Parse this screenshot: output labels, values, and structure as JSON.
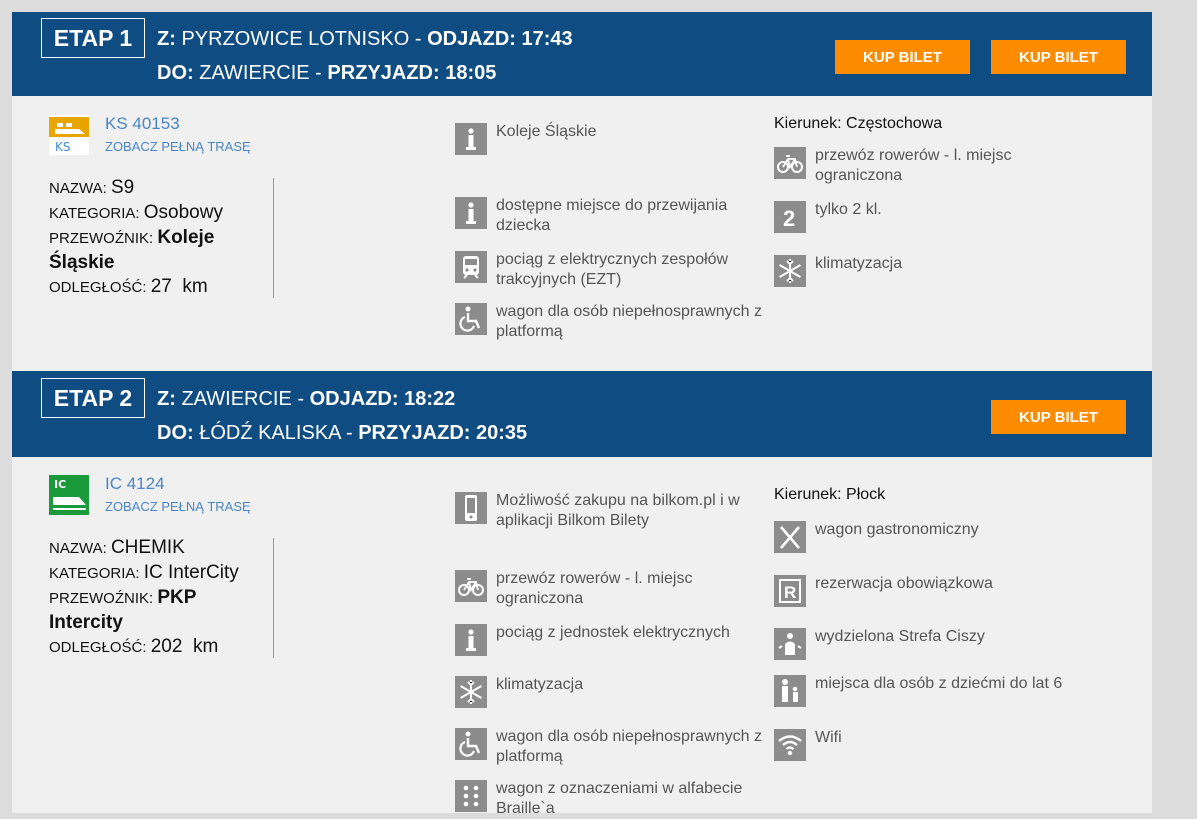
{
  "stages": [
    {
      "etap_label": "ETAP 1",
      "from_prefix": "Z:",
      "from_station": "PYRZOWICE LOTNISKO",
      "dep_label": "ODJAZD:",
      "dep_time": "17:43",
      "to_prefix": "DO:",
      "to_station": "ZAWIERCIE",
      "arr_label": "PRZYJAZD:",
      "arr_time": "18:05",
      "separator": "-",
      "buy_buttons": [
        "KUP BILET",
        "KUP BILET"
      ],
      "train_number": "KS 40153",
      "route_link": "ZOBACZ PEŁNĄ TRASĘ",
      "logo_text": "KS",
      "name_label": "NAZWA:",
      "name": "S9",
      "category_label": "KATEGORIA:",
      "category": "Osobowy",
      "carrier_label": "PRZEWOŹNIK:",
      "carrier_line1": "Koleje",
      "carrier_line2": "Śląskie",
      "distance_label": "ODLEGŁOŚĆ:",
      "distance": "27  km",
      "direction": "Kierunek: Częstochowa",
      "features_mid": [
        {
          "icon": "info-icon",
          "text": "Koleje Śląskie"
        },
        {
          "icon": "info-icon",
          "text": "dostępne miejsce do przewijania dziecka"
        },
        {
          "icon": "ezt-train-icon",
          "text": "pociąg z elektrycznych zespołów trakcyjnych (EZT)"
        },
        {
          "icon": "wheelchair-icon",
          "text": "wagon dla osób niepełnosprawnych z platformą"
        }
      ],
      "features_right": [
        {
          "icon": "bicycle-icon",
          "text": "przewóz rowerów - l. miejsc ograniczona"
        },
        {
          "icon": "second-class-icon",
          "text": "tylko 2 kl."
        },
        {
          "icon": "snowflake-icon",
          "text": "klimatyzacja"
        }
      ]
    },
    {
      "etap_label": "ETAP 2",
      "from_prefix": "Z:",
      "from_station": "ZAWIERCIE",
      "dep_label": "ODJAZD:",
      "dep_time": "18:22",
      "to_prefix": "DO:",
      "to_station": "ŁÓDŹ KALISKA",
      "arr_label": "PRZYJAZD:",
      "arr_time": "20:35",
      "separator": "-",
      "buy_buttons": [
        "KUP BILET"
      ],
      "train_number": "IC 4124",
      "route_link": "ZOBACZ PEŁNĄ TRASĘ",
      "logo_text": "IC",
      "name_label": "NAZWA:",
      "name": "CHEMIK",
      "category_label": "KATEGORIA:",
      "category": "IC InterCity",
      "carrier_label": "PRZEWOŹNIK:",
      "carrier_line1": "PKP",
      "carrier_line2": "Intercity",
      "distance_label": "ODLEGŁOŚĆ:",
      "distance": "202  km",
      "direction": "Kierunek: Płock",
      "features_mid": [
        {
          "icon": "mobile-phone-icon",
          "text": "Możliwość zakupu na bilkom.pl i w aplikacji Bilkom Bilety"
        },
        {
          "icon": "bicycle-icon",
          "text": "przewóz rowerów - l. miejsc ograniczona"
        },
        {
          "icon": "info-icon",
          "text": "pociąg z jednostek elektrycznych"
        },
        {
          "icon": "snowflake-icon",
          "text": "klimatyzacja"
        },
        {
          "icon": "wheelchair-icon",
          "text": "wagon dla osób niepełnosprawnych z platformą"
        },
        {
          "icon": "braille-icon",
          "text": "wagon z oznaczeniami w alfabecie Braille`a"
        }
      ],
      "features_right": [
        {
          "icon": "cutlery-icon",
          "text": "wagon gastronomiczny"
        },
        {
          "icon": "reservation-icon",
          "text": "rezerwacja obowiązkowa"
        },
        {
          "icon": "quiet-zone-icon",
          "text": "wydzielona Strefa Ciszy"
        },
        {
          "icon": "children-icon",
          "text": "miejsca dla osób z dziećmi do lat 6"
        },
        {
          "icon": "wifi-icon",
          "text": "Wifi"
        }
      ]
    }
  ],
  "colors": {
    "header_bg": "#0f4c81",
    "button_bg": "#ff8c00",
    "link": "#4a86c5",
    "ks_logo": "#e8a500",
    "ic_logo": "#1a9a3a"
  }
}
